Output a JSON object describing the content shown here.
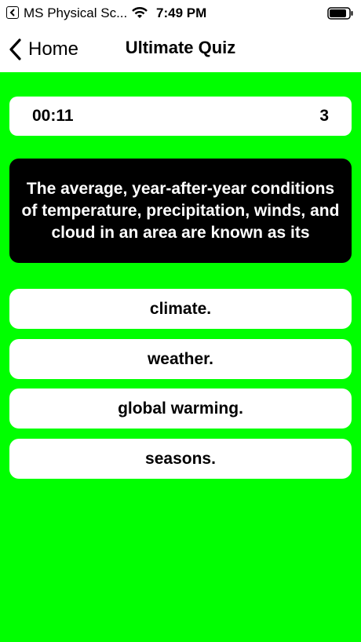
{
  "status_bar": {
    "app_name": "MS Physical Sc...",
    "time": "7:49 PM",
    "icons": [
      "back-to-app-icon",
      "wifi-icon",
      "battery-icon"
    ]
  },
  "nav": {
    "back_label": "Home",
    "title": "Ultimate Quiz"
  },
  "quiz": {
    "timer": "00:11",
    "score": "3",
    "question": "The average, year-after-year conditions of temperature, precipitation, winds, and cloud in an area are known as its",
    "answers": [
      {
        "label": "climate."
      },
      {
        "label": "weather."
      },
      {
        "label": "global warming."
      },
      {
        "label": "seasons."
      }
    ]
  },
  "colors": {
    "background": "#00ff00",
    "question_bg": "#000000",
    "card_bg": "#ffffff",
    "text": "#000000"
  }
}
